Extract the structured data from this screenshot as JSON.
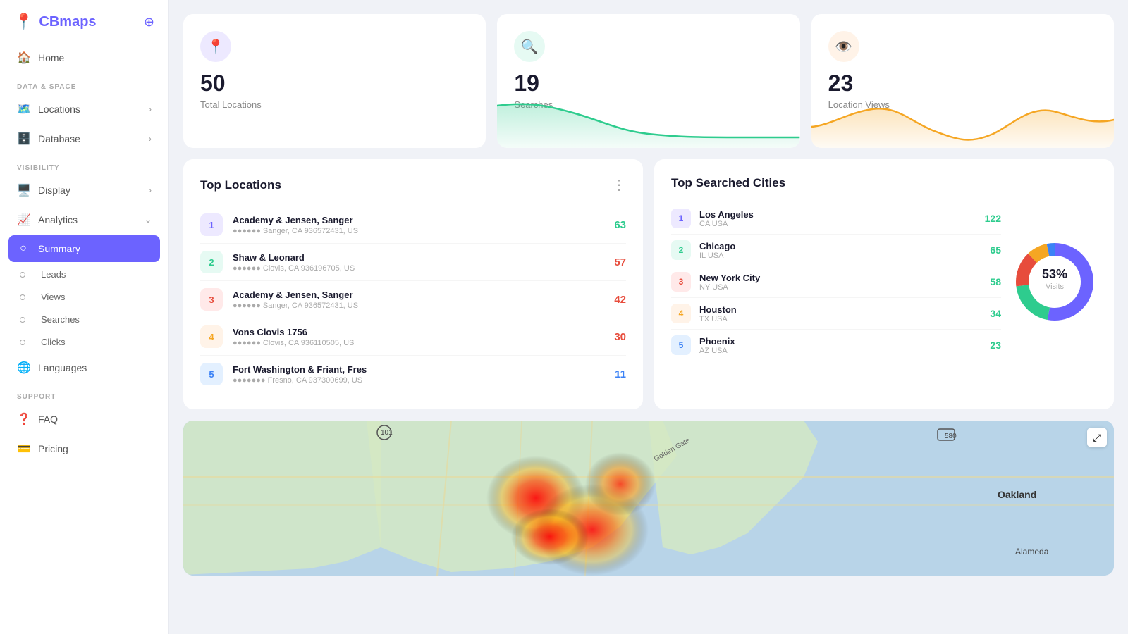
{
  "app": {
    "logo": "CBmaps",
    "logo_icon": "📍",
    "target_icon": "⊕"
  },
  "sidebar": {
    "nav_home": "Home",
    "section_data": "DATA & SPACE",
    "nav_locations": "Locations",
    "nav_database": "Database",
    "section_visibility": "VISIBILITY",
    "nav_display": "Display",
    "nav_analytics": "Analytics",
    "nav_summary": "Summary",
    "nav_leads": "Leads",
    "nav_views": "Views",
    "nav_searches": "Searches",
    "nav_clicks": "Clicks",
    "nav_languages": "Languages",
    "section_support": "SUPPORT",
    "nav_faq": "FAQ",
    "nav_pricing": "Pricing"
  },
  "stats": {
    "locations": {
      "value": "50",
      "label": "Total Locations"
    },
    "searches": {
      "value": "19",
      "label": "Searches"
    },
    "location_views": {
      "value": "23",
      "label": "Location Views"
    }
  },
  "top_locations": {
    "title": "Top Locations",
    "items": [
      {
        "rank": "1",
        "name": "Academy & Jensen, Sanger",
        "addr": "●●●●●● Sanger, CA 936572431, US",
        "count": "63",
        "color_class": "count-green",
        "num_class": "num-purple"
      },
      {
        "rank": "2",
        "name": "Shaw & Leonard",
        "addr": "●●●●●● Clovis, CA 936196705, US",
        "count": "57",
        "color_class": "count-red",
        "num_class": "num-green"
      },
      {
        "rank": "3",
        "name": "Academy & Jensen, Sanger",
        "addr": "●●●●●● Sanger, CA 936572431, US",
        "count": "42",
        "color_class": "count-red",
        "num_class": "num-red"
      },
      {
        "rank": "4",
        "name": "Vons Clovis 1756",
        "addr": "●●●●●● Clovis, CA 936110505, US",
        "count": "30",
        "color_class": "count-red",
        "num_class": "num-orange"
      },
      {
        "rank": "5",
        "name": "Fort Washington & Friant, Fres",
        "addr": "●●●●●●● Fresno, CA 937300699, US",
        "count": "11",
        "color_class": "count-blue",
        "num_class": "num-blue"
      }
    ]
  },
  "top_cities": {
    "title": "Top Searched Cities",
    "donut_percent": "53%",
    "donut_label": "Visits",
    "items": [
      {
        "rank": "1",
        "name": "Los Angeles",
        "sub": "CA USA",
        "count": "122",
        "num_class": "num-purple"
      },
      {
        "rank": "2",
        "name": "Chicago",
        "sub": "IL USA",
        "count": "65",
        "num_class": "num-green"
      },
      {
        "rank": "3",
        "name": "New York City",
        "sub": "NY USA",
        "count": "58",
        "num_class": "num-red"
      },
      {
        "rank": "4",
        "name": "Houston",
        "sub": "TX USA",
        "count": "34",
        "num_class": "num-orange"
      },
      {
        "rank": "5",
        "name": "Phoenix",
        "sub": "AZ USA",
        "count": "23",
        "num_class": "num-blue"
      }
    ]
  },
  "colors": {
    "purple": "#6c63ff",
    "green": "#2ecc8e",
    "red": "#e74c3c",
    "orange": "#f5a623",
    "blue": "#3b82f6"
  }
}
